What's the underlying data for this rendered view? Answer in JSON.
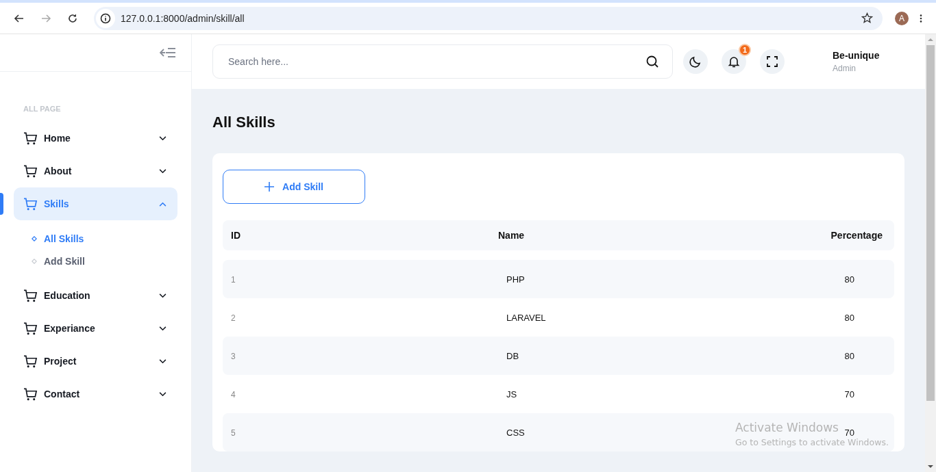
{
  "browser": {
    "url": "127.0.0.1:8000/admin/skill/all",
    "back_disabled": false,
    "forward_disabled": true,
    "profile_initial": "A"
  },
  "sidebar": {
    "section_label": "ALL PAGE",
    "items": [
      {
        "label": "Home",
        "selected": false,
        "expanded": false
      },
      {
        "label": "About",
        "selected": false,
        "expanded": false
      },
      {
        "label": "Skills",
        "selected": true,
        "expanded": true,
        "children": [
          {
            "label": "All Skills",
            "selected": true
          },
          {
            "label": "Add Skill",
            "selected": false
          }
        ]
      },
      {
        "label": "Education",
        "selected": false,
        "expanded": false
      },
      {
        "label": "Experiance",
        "selected": false,
        "expanded": false
      },
      {
        "label": "Project",
        "selected": false,
        "expanded": false
      },
      {
        "label": "Contact",
        "selected": false,
        "expanded": false
      }
    ]
  },
  "header": {
    "search": {
      "placeholder": "Search here..."
    },
    "notification_count": "1",
    "user": {
      "name": "Be-unique",
      "role": "Admin"
    }
  },
  "page_title": "All Skills",
  "add_button": "Add Skill",
  "table": {
    "columns": [
      "ID",
      "Name",
      "Percentage"
    ],
    "rows": [
      [
        "1",
        "PHP",
        "80"
      ],
      [
        "2",
        "LARAVEL",
        "80"
      ],
      [
        "3",
        "DB",
        "80"
      ],
      [
        "4",
        "JS",
        "70"
      ],
      [
        "5",
        "CSS",
        "70"
      ]
    ]
  },
  "os_notice": {
    "title": "Activate Windows",
    "text": "Go to Settings to activate Windows."
  }
}
